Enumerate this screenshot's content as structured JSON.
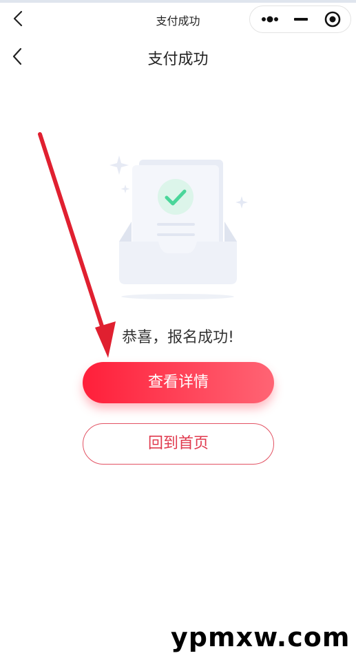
{
  "navbar": {
    "title": "支付成功",
    "back_icon": "chevron-left-icon",
    "capsule_icons": [
      "more-icon",
      "minus-icon",
      "target-icon"
    ]
  },
  "header": {
    "title": "支付成功",
    "back_icon": "chevron-left-icon"
  },
  "illustration": {
    "icon": "success-inbox-illustration",
    "check_color": "#4ad69a"
  },
  "message": "恭喜，报名成功!",
  "buttons": {
    "primary": "查看详情",
    "secondary": "回到首页"
  },
  "colors": {
    "primary_gradient_start": "#ff1f3a",
    "primary_gradient_end": "#ff6474",
    "secondary_border": "#e25162",
    "annotation_arrow": "#e02030"
  },
  "watermark": "ypmxw.com"
}
